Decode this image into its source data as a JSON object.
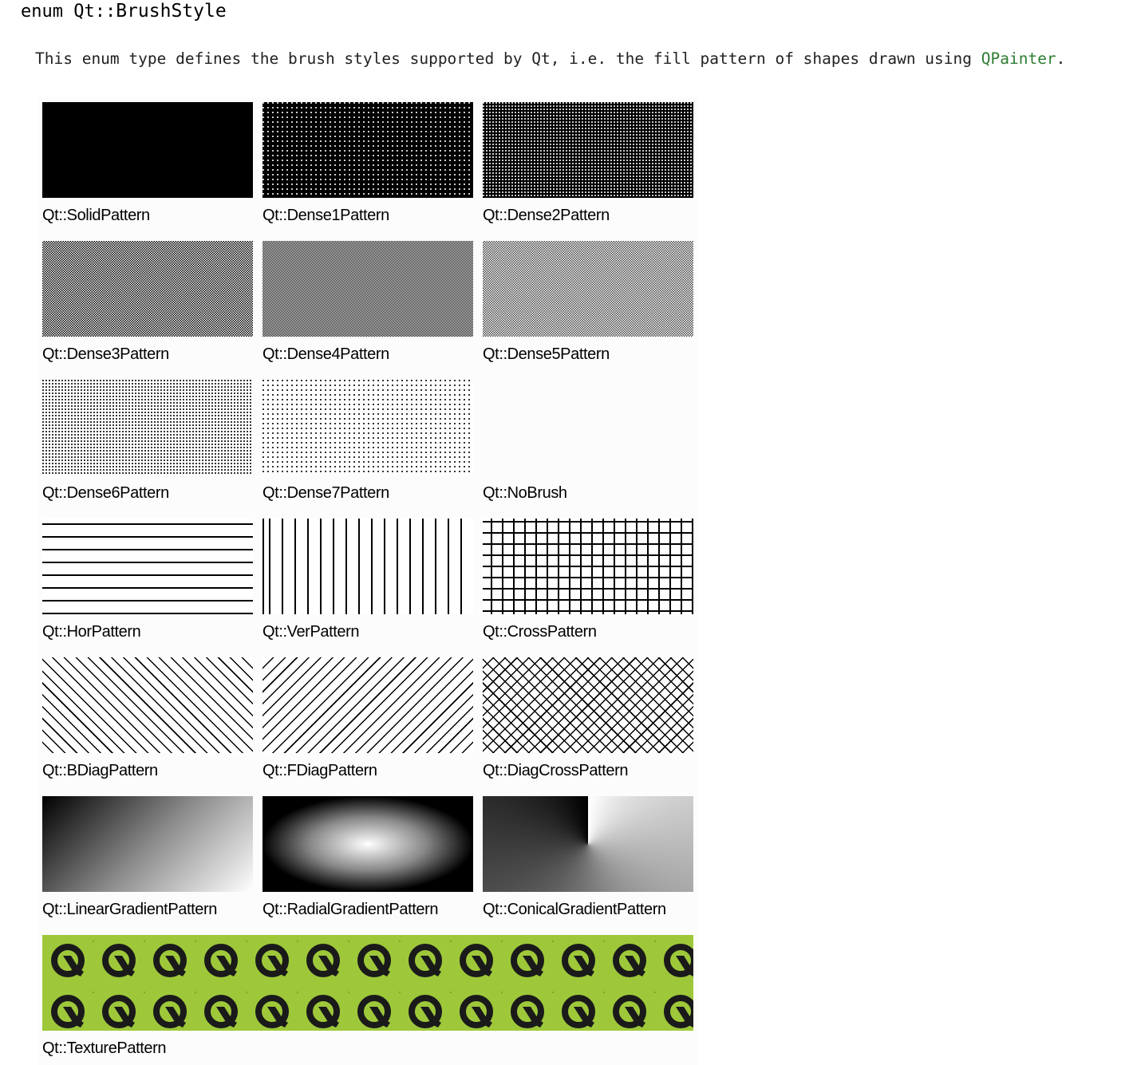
{
  "heading": {
    "prefix": "enum Qt::",
    "name": "BrushStyle"
  },
  "description": {
    "text": "This enum type defines the brush styles supported by Qt, i.e. the fill pattern of shapes drawn using ",
    "link": "QPainter",
    "suffix": "."
  },
  "patterns": [
    {
      "label": "Qt::SolidPattern",
      "style": "solid"
    },
    {
      "label": "Qt::Dense1Pattern",
      "style": "dense1"
    },
    {
      "label": "Qt::Dense2Pattern",
      "style": "dense2"
    },
    {
      "label": "Qt::Dense3Pattern",
      "style": "dense3"
    },
    {
      "label": "Qt::Dense4Pattern",
      "style": "dense4"
    },
    {
      "label": "Qt::Dense5Pattern",
      "style": "dense5"
    },
    {
      "label": "Qt::Dense6Pattern",
      "style": "dense6"
    },
    {
      "label": "Qt::Dense7Pattern",
      "style": "dense7"
    },
    {
      "label": "Qt::NoBrush",
      "style": "nobrush"
    },
    {
      "label": "Qt::HorPattern",
      "style": "hor"
    },
    {
      "label": "Qt::VerPattern",
      "style": "ver"
    },
    {
      "label": "Qt::CrossPattern",
      "style": "cross"
    },
    {
      "label": "Qt::BDiagPattern",
      "style": "bdiag"
    },
    {
      "label": "Qt::FDiagPattern",
      "style": "fdiag"
    },
    {
      "label": "Qt::DiagCrossPattern",
      "style": "diagcross"
    },
    {
      "label": "Qt::LinearGradientPattern",
      "style": "linear"
    },
    {
      "label": "Qt::RadialGradientPattern",
      "style": "radial"
    },
    {
      "label": "Qt::ConicalGradientPattern",
      "style": "conical"
    },
    {
      "label": "Qt::TexturePattern",
      "style": "texture"
    }
  ],
  "colors": {
    "link": "#2e7d32",
    "texture_background": "#9ec83a",
    "texture_logo": "#1a1a1a"
  }
}
